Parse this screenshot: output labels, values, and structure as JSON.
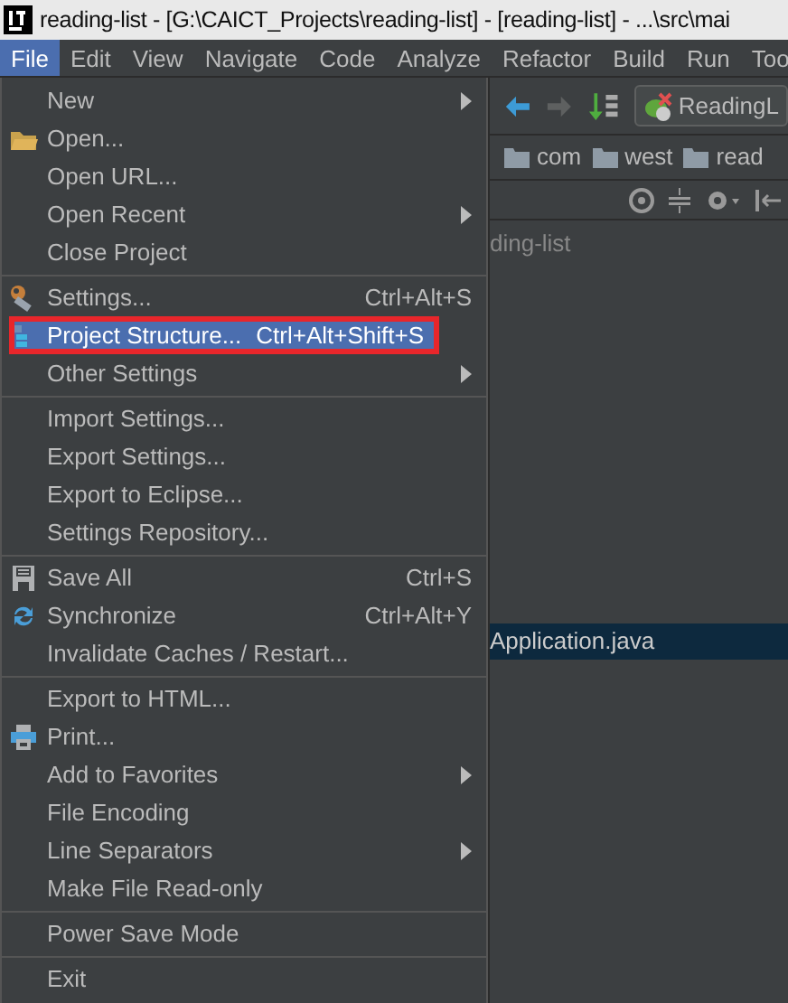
{
  "window": {
    "title": "reading-list - [G:\\CAICT_Projects\\reading-list] - [reading-list] - ...\\src\\mai"
  },
  "menu_bar": [
    {
      "label": "File",
      "selected": true
    },
    {
      "label": "Edit",
      "selected": false
    },
    {
      "label": "View",
      "selected": false
    },
    {
      "label": "Navigate",
      "selected": false
    },
    {
      "label": "Code",
      "selected": false
    },
    {
      "label": "Analyze",
      "selected": false
    },
    {
      "label": "Refactor",
      "selected": false
    },
    {
      "label": "Build",
      "selected": false
    },
    {
      "label": "Run",
      "selected": false
    },
    {
      "label": "Too",
      "selected": false
    }
  ],
  "file_menu": [
    [
      {
        "label": "New",
        "submenu": true,
        "selected": false
      },
      {
        "label": "Open...",
        "selected": false
      },
      {
        "label": "Open URL...",
        "selected": false
      },
      {
        "label": "Open Recent",
        "submenu": true,
        "selected": false
      },
      {
        "label": "Close Project",
        "selected": false
      }
    ],
    [
      {
        "label": "Settings...",
        "shortcut": "Ctrl+Alt+S",
        "selected": false
      },
      {
        "label": "Project Structure...",
        "shortcut": "Ctrl+Alt+Shift+S",
        "selected": true,
        "outlined": true
      },
      {
        "label": "Other Settings",
        "submenu": true,
        "selected": false
      }
    ],
    [
      {
        "label": "Import Settings...",
        "selected": false
      },
      {
        "label": "Export Settings...",
        "selected": false
      },
      {
        "label": "Export to Eclipse...",
        "selected": false
      },
      {
        "label": "Settings Repository...",
        "selected": false
      }
    ],
    [
      {
        "label": "Save All",
        "shortcut": "Ctrl+S",
        "selected": false
      },
      {
        "label": "Synchronize",
        "shortcut": "Ctrl+Alt+Y",
        "selected": false
      },
      {
        "label": "Invalidate Caches / Restart...",
        "selected": false
      }
    ],
    [
      {
        "label": "Export to HTML...",
        "selected": false
      },
      {
        "label": "Print...",
        "selected": false
      },
      {
        "label": "Add to Favorites",
        "submenu": true,
        "selected": false
      },
      {
        "label": "File Encoding",
        "selected": false
      },
      {
        "label": "Line Separators",
        "submenu": true,
        "selected": false
      },
      {
        "label": "Make File Read-only",
        "selected": false
      }
    ],
    [
      {
        "label": "Power Save Mode",
        "selected": false
      }
    ],
    [
      {
        "label": "Exit",
        "selected": false
      }
    ]
  ],
  "toolbar": {
    "run_config": "ReadingL"
  },
  "breadcrumbs": [
    "com",
    "west",
    "read"
  ],
  "project_tree": [
    {
      "label": "ding-list",
      "selected": false
    },
    {
      "label": "Application.java",
      "selected": true
    }
  ]
}
